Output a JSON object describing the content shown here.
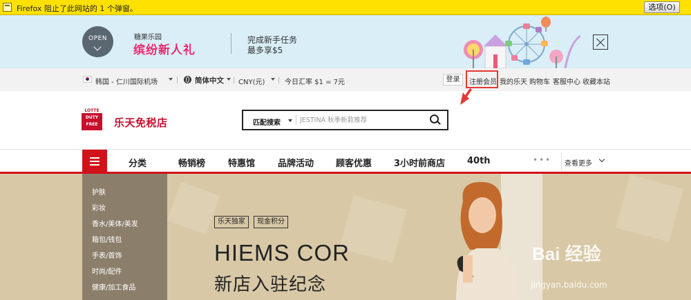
{
  "firefox_bar": {
    "message": "Firefox 阻止了此网站的 1 个弹窗。",
    "options_button": "选项(O)"
  },
  "promo": {
    "open_label": "OPEN",
    "small_text": "糖果乐园",
    "big_text": "缤纷新人礼",
    "line1": "完成新手任务",
    "line2": "最多享$5"
  },
  "utility": {
    "location": "韩国 - 仁川国际机场",
    "language": "简体中文",
    "currency": "CNY(元)",
    "exchange_rate": "今日汇率 $1 = 7元",
    "login": "登录",
    "links": [
      "注册会员",
      "我的乐天",
      "购物车",
      "客服中心",
      "收藏本站"
    ]
  },
  "header": {
    "logo_line1": "LOTTE",
    "logo_line2": "DUTY",
    "logo_line3": "FREE",
    "logo_name": "乐天免税店",
    "search_type": "匹配搜索",
    "search_placeholder": "JESTINA 秋季新款推荐"
  },
  "nav": {
    "items": [
      "分类",
      "畅销榜",
      "特惠馆",
      "品牌活动",
      "顾客优惠",
      "3小时前商店",
      "40th"
    ],
    "dots": "•••",
    "more": "查看更多"
  },
  "hero": {
    "categories": [
      "护肤",
      "彩妆",
      "香水/美体/美发",
      "箱包/钱包",
      "手表/首饰",
      "时尚/配件",
      "健康/加工食品"
    ],
    "badges": [
      "乐天独家",
      "现金积分"
    ],
    "title": "HIEMS COR",
    "subtitle": "新店入驻纪念",
    "watermark": "Bai 经验",
    "watermark_url": "jingyan.baidu.com"
  },
  "colors": {
    "brand_red": "#d0121b",
    "promo_pink": "#ea2a6e",
    "firefox_yellow": "#ffe100",
    "hero_bg": "#d8c8a6"
  }
}
